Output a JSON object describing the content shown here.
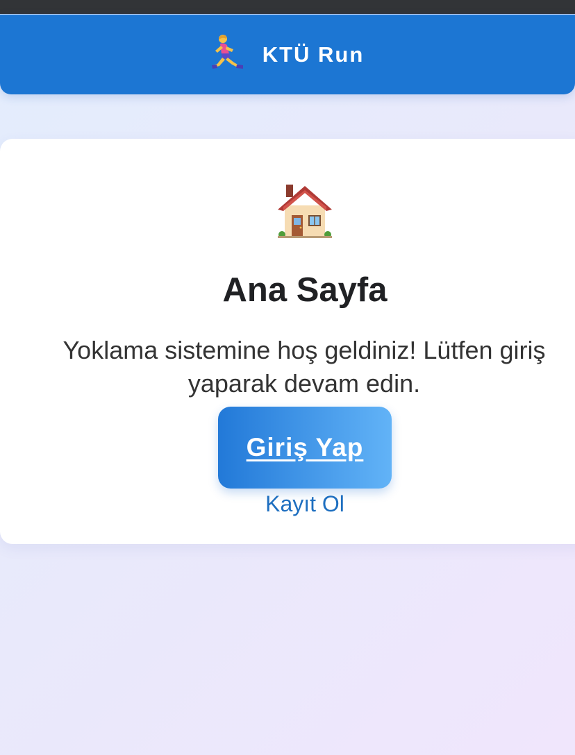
{
  "header": {
    "app_title": "KTÜ Run",
    "logo_icon": "runner-icon",
    "background_color": "#1c76d3"
  },
  "main": {
    "page_icon": "house-icon",
    "page_title": "Ana Sayfa",
    "welcome_text": "Yoklama sistemine hoş geldiniz! Lütfen giriş yaparak devam edin.",
    "login_button_label": "Giriş Yap",
    "register_link_label": "Kayıt Ol",
    "accent_color": "#2279d8",
    "link_color": "#1e6fc0"
  }
}
